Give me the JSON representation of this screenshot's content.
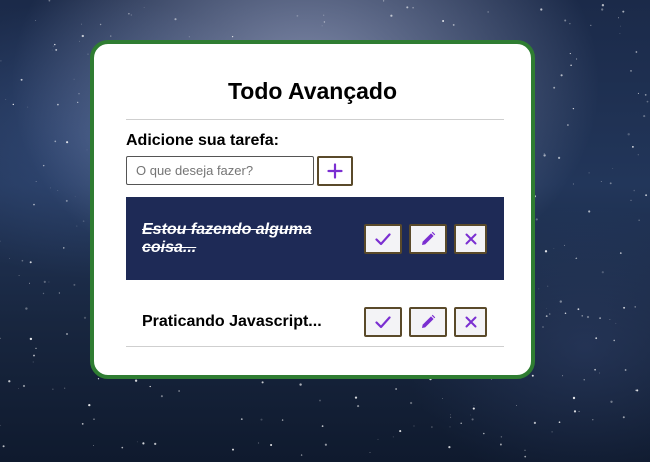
{
  "app": {
    "title": "Todo Avançado",
    "accent_color": "#2f7d32",
    "icon_color": "#7b2fd1",
    "done_row_color": "#1e2a56"
  },
  "form": {
    "label": "Adicione sua tarefa:",
    "placeholder": "O que deseja fazer?",
    "value": "",
    "add_button_icon": "plus-icon"
  },
  "todos": [
    {
      "text": "Estou fazendo alguma coisa...",
      "done": true,
      "actions": [
        "check-icon",
        "pencil-icon",
        "close-icon"
      ]
    },
    {
      "text": "Praticando Javascript...",
      "done": false,
      "actions": [
        "check-icon",
        "pencil-icon",
        "close-icon"
      ]
    }
  ]
}
